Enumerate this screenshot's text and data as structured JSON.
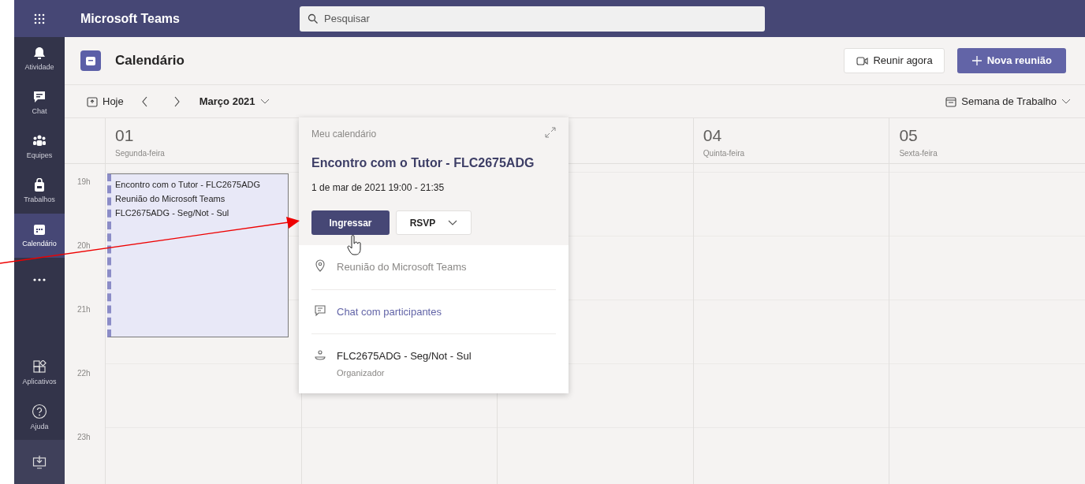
{
  "topbar": {
    "title": "Microsoft Teams",
    "search": {
      "placeholder": "Pesquisar"
    }
  },
  "sidebar": {
    "items": [
      {
        "kind": "bell",
        "label": "Atividade",
        "selected": false
      },
      {
        "kind": "chat",
        "label": "Chat",
        "selected": false
      },
      {
        "kind": "people",
        "label": "Equipes",
        "selected": false
      },
      {
        "kind": "bag",
        "label": "Trabalhos",
        "selected": false
      },
      {
        "kind": "calendar",
        "label": "Calendário",
        "selected": true
      },
      {
        "kind": "more",
        "selected": false
      }
    ],
    "bottom_items": [
      {
        "kind": "apps",
        "label": "Aplicativos"
      },
      {
        "kind": "help",
        "label": "Ajuda"
      },
      {
        "kind": "download"
      }
    ]
  },
  "header": {
    "title": "Calendário",
    "meet_now": "Reunir agora",
    "new_meeting": "Nova reunião"
  },
  "toolbar": {
    "today": "Hoje",
    "month": "Março 2021",
    "view": "Semana de Trabalho"
  },
  "days": [
    {
      "number": "01",
      "weekday": "Segunda-feira"
    },
    {
      "number": "04",
      "weekday": "Quinta-feira"
    },
    {
      "number": "05",
      "weekday": "Sexta-feira"
    }
  ],
  "hours": [
    "19h",
    "20h",
    "21h",
    "22h",
    "23h"
  ],
  "event": {
    "lines": [
      "Encontro com o Tutor - FLC2675ADG",
      "Reunião do Microsoft Teams",
      "FLC2675ADG - Seg/Not - Sul"
    ]
  },
  "popup": {
    "calendar": "Meu calendário",
    "title": "Encontro com o Tutor - FLC2675ADG",
    "when": "1 de mar de 2021 19:00 - 21:35",
    "join": "Ingressar",
    "rsvp": "RSVP",
    "details": [
      {
        "kind": "location",
        "text": "Reunião do Microsoft Teams",
        "link": false
      },
      {
        "kind": "chat",
        "text": "Chat com participantes",
        "link": true
      },
      {
        "kind": "organizer",
        "text": "FLC2675ADG - Seg/Not - Sul",
        "sub": "Organizador",
        "link": false
      }
    ]
  }
}
